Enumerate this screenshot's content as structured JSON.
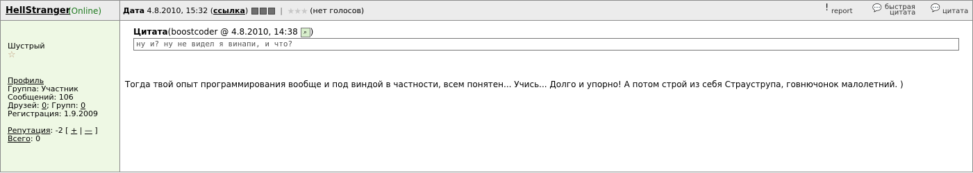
{
  "author": {
    "name": "HellStranger",
    "status": "(Online)"
  },
  "header": {
    "date_label": "Дата",
    "date_value": "4.8.2010, 15:32",
    "paren_open": "(",
    "link_label": "ссылка",
    "paren_close": ")",
    "separator": "|",
    "votes_text": "(нет голосов)",
    "actions": {
      "report": "report",
      "quick_quote_line1": "быстрая",
      "quick_quote_line2": "цитата",
      "quote": "цитата"
    }
  },
  "sidebar": {
    "rank": "Шустрый",
    "profile_link": "Профиль",
    "group": "Группа: Участник",
    "messages": "Сообщений: 106",
    "friends_label": "Друзей:",
    "friends_value": "0",
    "groups_label": "; Групп:",
    "groups_value": "0",
    "registered": "Регистрация: 1.9.2009",
    "reputation_label": "Репутация",
    "reputation_value": ": -2 [",
    "rep_plus": "+",
    "rep_sep": "|",
    "rep_minus": "—",
    "rep_close": "]",
    "total_label": "Всего",
    "total_value": ": 0"
  },
  "post": {
    "quote_label": "Цитата",
    "quote_meta": "(boostcoder @  4.8.2010,  14:38",
    "quote_meta_close": ")",
    "quote_text": "ну и? ну не видел я винапи, и что?",
    "message": "Тогда твой опыт программирования вообще и под виндой в частности, всем понятен... Учись... Долго и упорно! А потом строй из себя Страуструпа, говнючонок малолетний. )"
  },
  "icons": {
    "report": "exclamation-icon",
    "quick_quote": "quote-bubble-icon",
    "quote": "quote-bubble-icon",
    "rank_star": "star-icon",
    "quote_view": "magnifier-icon"
  },
  "colors": {
    "header_bg": "#ececec",
    "sidebar_bg": "#eef8e4",
    "online": "#1e7a1e",
    "border": "#8c8c8c"
  }
}
